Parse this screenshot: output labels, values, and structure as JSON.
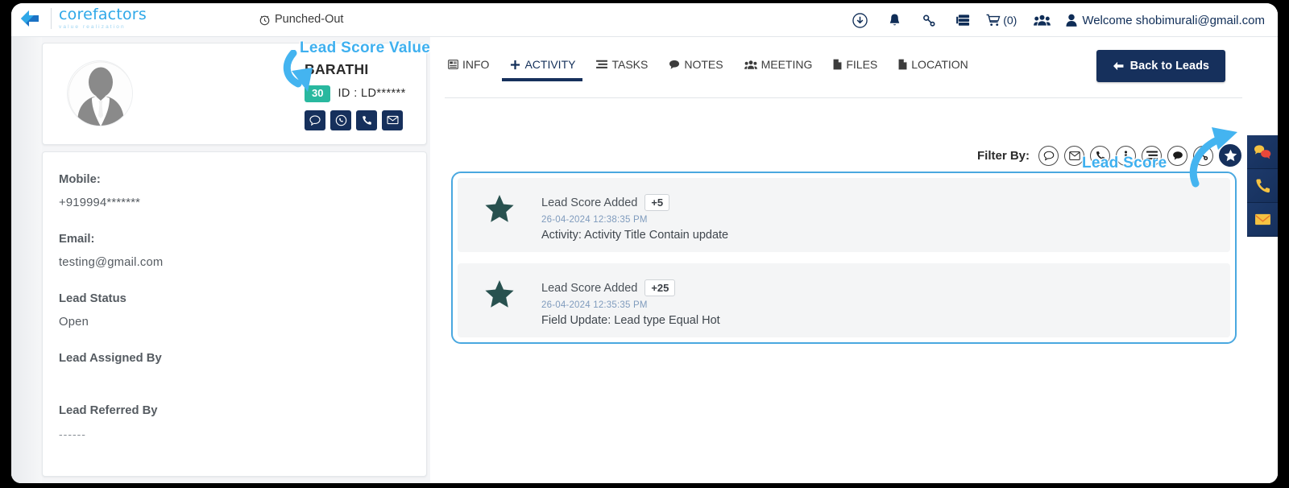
{
  "header": {
    "brand_name": "corefactors",
    "brand_tagline": "value realization",
    "punched_status": "Punched-Out",
    "cart_count": "(0)",
    "welcome_text": "Welcome shobimurali@gmail.com",
    "icons": [
      "download-icon",
      "bell-icon",
      "link-icon",
      "server-icon",
      "cart-icon",
      "users-icon",
      "user-icon"
    ]
  },
  "profile": {
    "name": "BARATHI",
    "lead_score": "30",
    "lead_id": "ID : LD******",
    "actions": [
      "sms-icon",
      "whatsapp-icon",
      "call-icon",
      "email-icon"
    ]
  },
  "details": {
    "fields": [
      {
        "label": "Mobile:",
        "value": "+919994*******"
      },
      {
        "label": "Email:",
        "value": "testing@gmail.com"
      },
      {
        "label": "Lead Status",
        "value": "Open"
      },
      {
        "label": "Lead Assigned By",
        "value": ""
      },
      {
        "label": "Lead Referred By",
        "value": "------"
      }
    ]
  },
  "tabs": [
    {
      "label": "INFO",
      "icon": "info-grid-icon",
      "active": false
    },
    {
      "label": "ACTIVITY",
      "icon": "plus-icon",
      "active": true
    },
    {
      "label": "TASKS",
      "icon": "tasks-icon",
      "active": false
    },
    {
      "label": "NOTES",
      "icon": "notes-icon",
      "active": false
    },
    {
      "label": "MEETING",
      "icon": "meeting-icon",
      "active": false
    },
    {
      "label": "FILES",
      "icon": "file-icon",
      "active": false
    },
    {
      "label": "LOCATION",
      "icon": "location-icon",
      "active": false
    }
  ],
  "back_button": {
    "label": "Back to Leads",
    "icon": "arrow-left-icon"
  },
  "filter": {
    "label": "Filter By:",
    "options": [
      {
        "name": "chat-filter",
        "icon": "speech-bubble-icon",
        "active": false
      },
      {
        "name": "email-filter",
        "icon": "envelope-icon",
        "active": false
      },
      {
        "name": "call-filter",
        "icon": "phone-icon",
        "active": false
      },
      {
        "name": "info-filter",
        "icon": "info-icon",
        "active": false
      },
      {
        "name": "task-filter",
        "icon": "list-icon",
        "active": false
      },
      {
        "name": "note-filter",
        "icon": "comment-icon",
        "active": false
      },
      {
        "name": "link-filter",
        "icon": "link-icon",
        "active": false
      },
      {
        "name": "lead-score-filter",
        "icon": "star-icon",
        "active": true
      }
    ]
  },
  "activities": [
    {
      "title": "Lead Score Added",
      "points": "+5",
      "timestamp": "26-04-2024 12:38:35 PM",
      "description": "Activity: Activity Title Contain update",
      "icon": "star-icon"
    },
    {
      "title": "Lead Score Added",
      "points": "+25",
      "timestamp": "26-04-2024 12:35:35 PM",
      "description": "Field Update: Lead type Equal Hot",
      "icon": "star-icon"
    }
  ],
  "float_buttons": [
    {
      "name": "chat-float",
      "icon": "chat-bubbles-icon"
    },
    {
      "name": "call-float",
      "icon": "phone-icon"
    },
    {
      "name": "email-float",
      "icon": "envelope-icon"
    }
  ],
  "annotations": [
    {
      "text": "Lead Score Value"
    },
    {
      "text": "Lead Score"
    }
  ],
  "colors": {
    "navy": "#16305c",
    "teal_badge": "#29b89f",
    "annotation_blue": "#3fb0ef",
    "card_border_blue": "#4aa8e0",
    "star_dark": "#28514f",
    "brand_blue": "#2fa8e8"
  }
}
